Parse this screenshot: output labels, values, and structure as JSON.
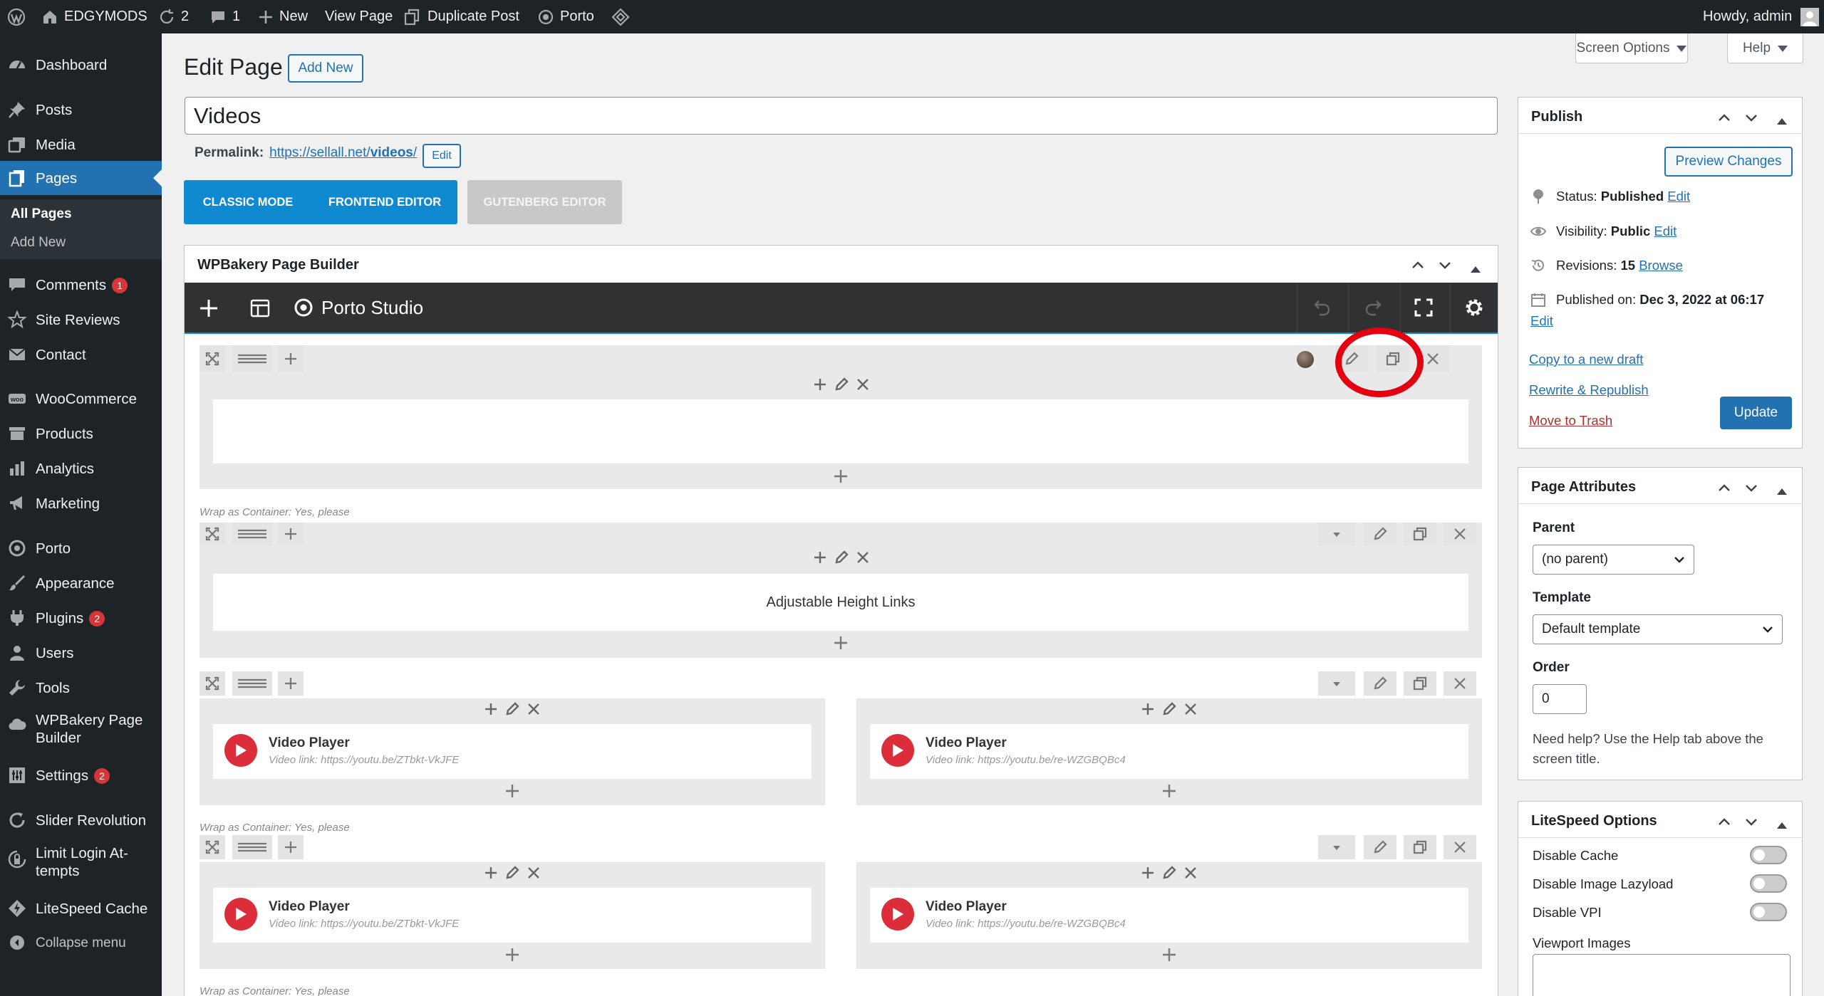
{
  "adminbar": {
    "site_name": "EDGYMODS",
    "updates_count": "2",
    "comments_count": "1",
    "new_label": "New",
    "view_page": "View Page",
    "duplicate_post": "Duplicate Post",
    "porto": "Porto",
    "howdy": "Howdy, admin"
  },
  "sidebar": {
    "dashboard": "Dashboard",
    "posts": "Posts",
    "media": "Media",
    "pages": "Pages",
    "all_pages": "All Pages",
    "add_new": "Add New",
    "comments": "Comments",
    "comments_badge": "1",
    "site_reviews": "Site Reviews",
    "contact": "Contact",
    "woocommerce": "WooCommerce",
    "products": "Products",
    "analytics": "Analytics",
    "marketing": "Marketing",
    "porto": "Porto",
    "appearance": "Appearance",
    "plugins": "Plugins",
    "plugins_badge": "2",
    "users": "Users",
    "tools": "Tools",
    "wpbakery_1": "WPBakery Page",
    "wpbakery_2": "Builder",
    "settings": "Settings",
    "settings_badge": "2",
    "slider_revolution": "Slider Revolution",
    "limit_login_1": "Limit Login At-",
    "limit_login_2": "tempts",
    "litespeed_cache": "LiteSpeed Cache",
    "collapse": "Collapse menu"
  },
  "header": {
    "screen_options": "Screen Options",
    "help": "Help",
    "title": "Edit Page",
    "add_new": "Add New"
  },
  "editor": {
    "post_title": "Videos",
    "permalink_label": "Permalink:",
    "permalink_base": "https://sellall.net/",
    "permalink_slug": "videos",
    "permalink_end": "/",
    "permalink_edit": "Edit",
    "classic_mode": "CLASSIC MODE",
    "frontend_editor": "FRONTEND EDITOR",
    "gutenberg_editor": "GUTENBERG EDITOR"
  },
  "builder": {
    "title": "WPBakery Page Builder",
    "studio": "Porto Studio",
    "wrap_note": "Wrap as Container: Yes, please",
    "adjustable_links": "Adjustable Height Links",
    "video_title": "Video Player",
    "video_link_1": "Video link: https://youtu.be/ZTbkt-VkJFE",
    "video_link_2": "Video link: https://youtu.be/re-WZGBQBc4"
  },
  "publish": {
    "title": "Publish",
    "preview": "Preview Changes",
    "status_label": "Status:",
    "status_value": "Published",
    "visibility_label": "Visibility:",
    "visibility_value": "Public",
    "revisions_label": "Revisions:",
    "revisions_value": "15",
    "browse": "Browse",
    "published_on_label": "Published on:",
    "published_on_value": "Dec 3, 2022 at 06:17",
    "edit": "Edit",
    "copy_draft": "Copy to a new draft",
    "rewrite": "Rewrite & Republish",
    "trash": "Move to Trash",
    "update": "Update"
  },
  "attributes": {
    "title": "Page Attributes",
    "parent_label": "Parent",
    "parent_value": "(no parent)",
    "template_label": "Template",
    "template_value": "Default template",
    "order_label": "Order",
    "order_value": "0",
    "help_1": "Need help? Use the Help tab above the",
    "help_2": "screen title."
  },
  "litespeed": {
    "title": "LiteSpeed Options",
    "disable_cache": "Disable Cache",
    "disable_lazyload": "Disable Image Lazyload",
    "disable_vpi": "Disable VPI",
    "viewport_images": "Viewport Images"
  },
  "colors": {
    "admin_bg": "#1d2327",
    "accent": "#2271b1",
    "builder_blue": "#0f8ad0",
    "highlight_ring": "#e5000f",
    "trash_red": "#b32d2e"
  }
}
